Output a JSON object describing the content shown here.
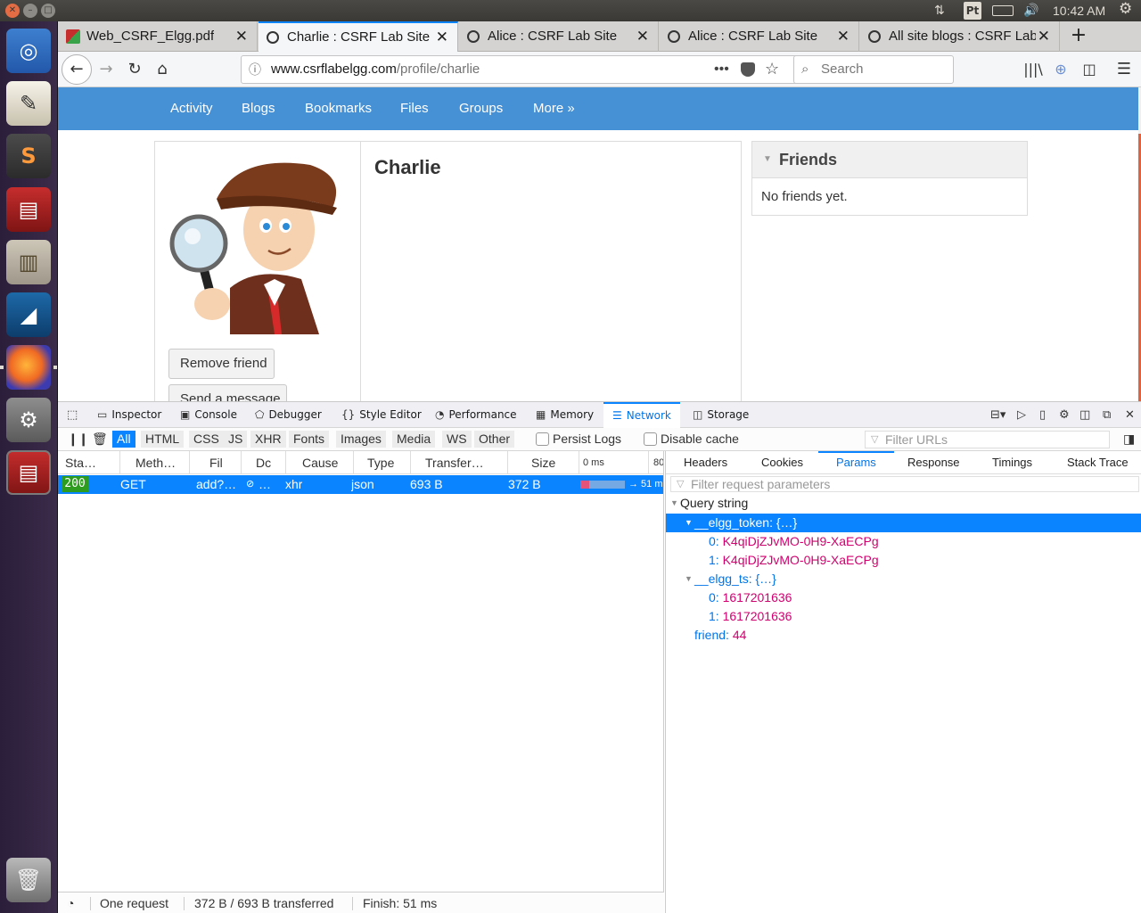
{
  "system": {
    "clock": "10:42 AM",
    "keyboard_layout": "Pt"
  },
  "browser": {
    "tabs": [
      {
        "label": "Web_CSRF_Elgg.pdf",
        "active": false
      },
      {
        "label": "Charlie : CSRF Lab Site",
        "active": true
      },
      {
        "label": "Alice : CSRF Lab Site",
        "active": false
      },
      {
        "label": "Alice : CSRF Lab Site",
        "active": false
      },
      {
        "label": "All site blogs : CSRF Lab Site",
        "active": false
      }
    ],
    "url_host": "www.csrflabelgg.com",
    "url_path": "/profile/charlie",
    "search_placeholder": "Search"
  },
  "site": {
    "nav": [
      "Activity",
      "Blogs",
      "Bookmarks",
      "Files",
      "Groups",
      "More »"
    ],
    "profile_name": "Charlie",
    "remove_friend_label": "Remove friend",
    "send_message_label": "Send a message",
    "friends_title": "Friends",
    "friends_empty": "No friends yet."
  },
  "devtools": {
    "tools": [
      "Inspector",
      "Console",
      "Debugger",
      "Style Editor",
      "Performance",
      "Memory",
      "Network",
      "Storage"
    ],
    "active_tool": "Network",
    "filters": [
      "All",
      "HTML",
      "CSS",
      "JS",
      "XHR",
      "Fonts",
      "Images",
      "Media",
      "WS",
      "Other"
    ],
    "persist_logs": "Persist Logs",
    "disable_cache": "Disable cache",
    "filter_urls_placeholder": "Filter URLs",
    "columns": [
      "Sta…",
      "Meth…",
      "Fil",
      "Dc",
      "Cause",
      "Type",
      "Transfer…",
      "Size",
      "0 ms",
      "80"
    ],
    "request": {
      "status": "200",
      "method": "GET",
      "file": "add?…",
      "domain": "…",
      "cause": "xhr",
      "type": "json",
      "transferred": "693 B",
      "size": "372 B",
      "timing": "→ 51 m"
    },
    "side_tabs": [
      "Headers",
      "Cookies",
      "Params",
      "Response",
      "Timings",
      "Stack Trace"
    ],
    "active_side_tab": "Params",
    "param_filter_placeholder": "Filter request parameters",
    "params": {
      "section": "Query string",
      "token_key": "__elgg_token:",
      "token_obj": "{…}",
      "token_values": [
        {
          "idx": "0:",
          "val": "K4qiDjZJvMO-0H9-XaECPg"
        },
        {
          "idx": "1:",
          "val": "K4qiDjZJvMO-0H9-XaECPg"
        }
      ],
      "ts_key": "__elgg_ts:",
      "ts_obj": "{…}",
      "ts_values": [
        {
          "idx": "0:",
          "val": "1617201636"
        },
        {
          "idx": "1:",
          "val": "1617201636"
        }
      ],
      "friend_key": "friend:",
      "friend_val": "44"
    },
    "status": {
      "requests": "One request",
      "transferred": "372 B / 693 B transferred",
      "finish": "Finish: 51 ms"
    }
  }
}
